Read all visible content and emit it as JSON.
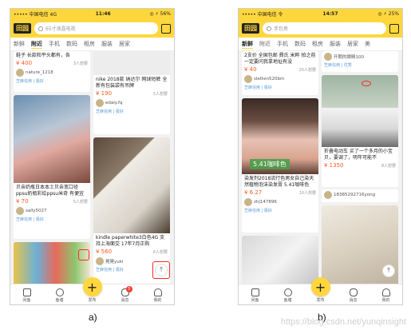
{
  "colors": {
    "brand_yellow": "#ffd73d",
    "price": "#ff5a1f",
    "alert": "#ff2a2a"
  },
  "phone_a": {
    "status": {
      "left": "••••• 中国电信  4G",
      "time": "11:46",
      "right": "◎ ⚡ 56%"
    },
    "logo": "田园",
    "search_placeholder": "65寸液晶电视",
    "tabs": [
      "新鲜",
      "附近",
      "手机",
      "数码",
      "租房",
      "服装",
      "居家"
    ],
    "active_tab": "附近",
    "cards": [
      {
        "title": "鞋子 长款和平头都有，各",
        "price": "¥ 400",
        "want": "3人想要",
        "seller": "nature_1218",
        "cert": "芝麻信用 | 极好"
      },
      {
        "title": "nike 2018款 纳达尔 网球短裤 全新有包装袋有吊牌",
        "price": "¥ 190",
        "want": "5人想要",
        "seller": "edaiy.fq",
        "cert": "芝麻信用 | 极好"
      },
      {
        "title": "贝亲奶瓶日本本土贝亲宽口径ppsu奶瓶彩绘ppsu米奇 有便宜",
        "price": "¥ 70",
        "want": "5人想要",
        "seller": "sally5027",
        "cert": "芝麻信用 | 极好"
      },
      {
        "title": "kindle paperwhite3白色4G 支持上海面交 17年7月正购",
        "price": "¥ 560",
        "want": "6人想要",
        "seller": "晃晃yuki",
        "cert": "芝麻信用 | 极好"
      }
    ],
    "nav": [
      "闲鱼",
      "鱼塘",
      "发布",
      "消息",
      "我的"
    ],
    "badge": "3",
    "caption": "a)"
  },
  "phone_b": {
    "status": {
      "left": "••••• 中国电信  令",
      "time": "14:57",
      "right": "◎ ⚡ 25%"
    },
    "logo": "田园",
    "search_placeholder": "手包男",
    "tabs": [
      "新鲜",
      "附近",
      "手机",
      "数码",
      "租房",
      "服装",
      "居家",
      "美"
    ],
    "active_tab": "新鲜",
    "cards": [
      {
        "title": "2支价 全国包邮 費氏 米粹 拍之前一定要问我拿地址有没",
        "price": "¥ 40",
        "want": "20人想要",
        "seller": "sletten520bm",
        "cert": "芝麻信用 | 极好"
      },
      {
        "title": "",
        "price": "",
        "want": "",
        "seller": "开朗的眼睛100",
        "cert": "芝麻信用 | 优秀"
      },
      {
        "title": "折叠电动车 买了一个多月的小宝贝，要调了，明年可能不",
        "price": "¥ 1350",
        "want": "8人想要",
        "seller": "18385292716yong",
        "cert": ""
      },
      {
        "title": "染发剂2018流行色男女自己染天然植物泡沫染发膏 5.41咖啡色",
        "price": "¥ 6.27",
        "want": "10人想要",
        "seller": "zhj147896",
        "cert": "芝麻信用 | 极好",
        "overlay": "5.41咖啡色"
      }
    ],
    "nav": [
      "闲鱼",
      "鱼塘",
      "发布",
      "消息",
      "我的"
    ],
    "caption": "b)"
  },
  "watermark": "https://blog.csdn.net/yunqinsight"
}
